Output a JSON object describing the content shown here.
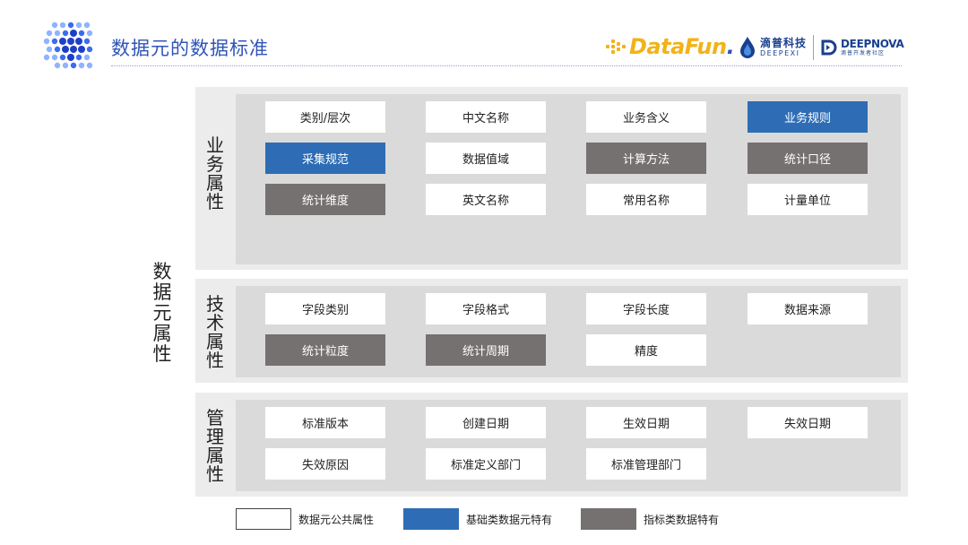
{
  "header": {
    "title": "数据元的数据标准",
    "datafun_brand": "DataFun",
    "datafun_dot": ".",
    "deepexi_cn": "滴普科技",
    "deepexi_en": "DEEPEXI",
    "deepnova_en": "DEEPNOVA",
    "deepnova_cn": "滴普开发者社区"
  },
  "side_label": "数据元属性",
  "sections": {
    "business": {
      "label": "业务属性",
      "rows": [
        [
          {
            "text": "类别/层次",
            "type": "white"
          },
          {
            "text": "中文名称",
            "type": "white"
          },
          {
            "text": "业务含义",
            "type": "white"
          },
          {
            "text": "业务规则",
            "type": "blue"
          }
        ],
        [
          {
            "text": "采集规范",
            "type": "blue"
          },
          {
            "text": "数据值域",
            "type": "white"
          },
          {
            "text": "计算方法",
            "type": "gray"
          },
          {
            "text": "统计口径",
            "type": "gray"
          }
        ],
        [
          {
            "text": "统计维度",
            "type": "gray"
          },
          {
            "text": "英文名称",
            "type": "white"
          },
          {
            "text": "常用名称",
            "type": "white"
          },
          {
            "text": "计量单位",
            "type": "white"
          }
        ]
      ]
    },
    "technical": {
      "label": "技术属性",
      "rows": [
        [
          {
            "text": "字段类别",
            "type": "white"
          },
          {
            "text": "字段格式",
            "type": "white"
          },
          {
            "text": "字段长度",
            "type": "white"
          },
          {
            "text": "数据来源",
            "type": "white"
          }
        ],
        [
          {
            "text": "统计粒度",
            "type": "gray"
          },
          {
            "text": "统计周期",
            "type": "gray"
          },
          {
            "text": "精度",
            "type": "white"
          }
        ]
      ]
    },
    "management": {
      "label": "管理属性",
      "rows": [
        [
          {
            "text": "标准版本",
            "type": "white"
          },
          {
            "text": "创建日期",
            "type": "white"
          },
          {
            "text": "生效日期",
            "type": "white"
          },
          {
            "text": "失效日期",
            "type": "white"
          }
        ],
        [
          {
            "text": "失效原因",
            "type": "white"
          },
          {
            "text": "标准定义部门",
            "type": "white"
          },
          {
            "text": "标准管理部门",
            "type": "white"
          }
        ]
      ]
    }
  },
  "legend": {
    "common": "数据元公共属性",
    "basic": "基础类数据元特有",
    "indicator": "指标类数据特有"
  },
  "colors": {
    "blue": "#2e6db5",
    "gray": "#757170",
    "title": "#2f55b8",
    "brand_yellow": "#f2b318"
  }
}
